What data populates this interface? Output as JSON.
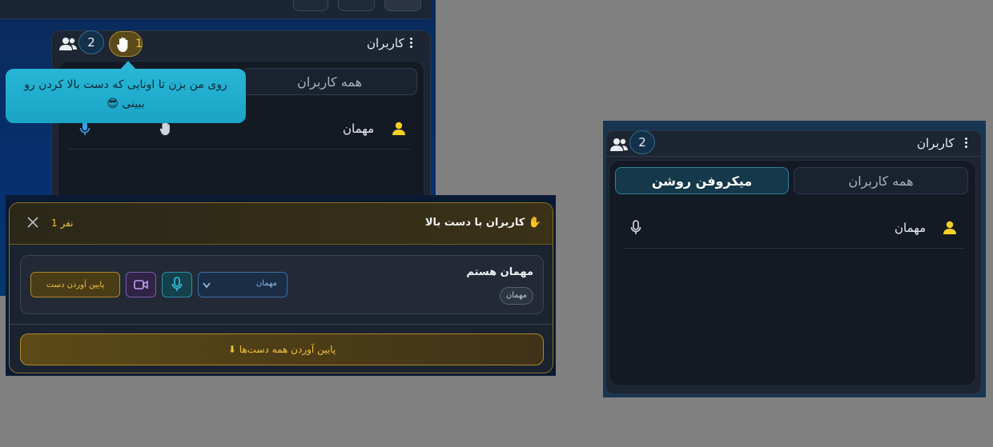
{
  "panel_top_left": {
    "title": "کاربران",
    "online_count": "2",
    "raised_hands_count": "1",
    "tabs": {
      "all_users": "همه کاربران"
    },
    "users": [
      {
        "name": "مهمان"
      }
    ],
    "tooltip": {
      "text": "روی من بزن تا اونایی که دست بالا کردن رو ببینی 😎"
    }
  },
  "raised_hands_modal": {
    "title": "✋ کاربران با دست بالا",
    "count_label": "1 نفر",
    "entries": [
      {
        "name": "مهمان هستم",
        "role_badge": "مهمان",
        "role_select": "مهمان",
        "lower_hand_label": "پایین آوردن دست"
      }
    ],
    "lower_all_label": "⬇ پایین آوردن همه دست‌ها"
  },
  "panel_right": {
    "title": "کاربران",
    "online_count": "2",
    "tabs": {
      "all_users": "همه کاربران",
      "mic_on": "میکروفن روشن"
    },
    "users": [
      {
        "name": "مهمان"
      }
    ]
  },
  "colors": {
    "accent_gold": "#f0c23a",
    "tooltip_cyan": "#27b6d6",
    "mic_blue": "#3aa0e6",
    "avatar_yellow": "#f5d020"
  }
}
